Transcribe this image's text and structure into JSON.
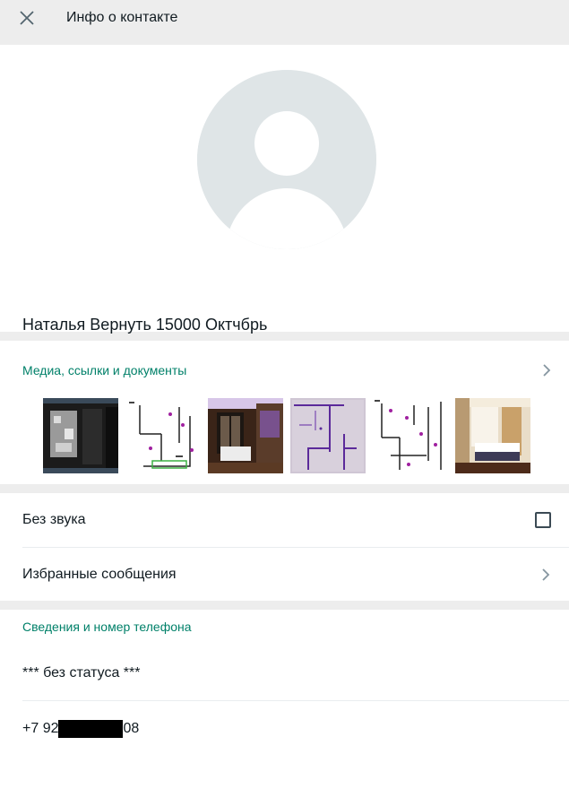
{
  "header": {
    "title": "Инфо о контакте",
    "close_icon": "close-icon"
  },
  "profile": {
    "name": "Наталья Вернуть 15000 Октчбрь",
    "avatar_icon": "default-avatar-icon"
  },
  "media": {
    "title": "Медиа, ссылки и документы",
    "thumbnail_count": 6,
    "thumbnails": [
      {
        "kind": "screenshot-dark"
      },
      {
        "kind": "floor-plan"
      },
      {
        "kind": "interior-photo"
      },
      {
        "kind": "floor-plan-sketch"
      },
      {
        "kind": "floor-plan"
      },
      {
        "kind": "bedroom-photo"
      }
    ]
  },
  "settings": {
    "mute_label": "Без звука",
    "mute_checked": false,
    "starred_label": "Избранные сообщения"
  },
  "info": {
    "title": "Сведения и номер телефона",
    "status": "*** без статуса ***",
    "phone_prefix": "+7 92",
    "phone_suffix": "08"
  },
  "colors": {
    "accent": "#008069",
    "header_bg": "#ededed",
    "avatar_bg": "#dfe5e7"
  }
}
